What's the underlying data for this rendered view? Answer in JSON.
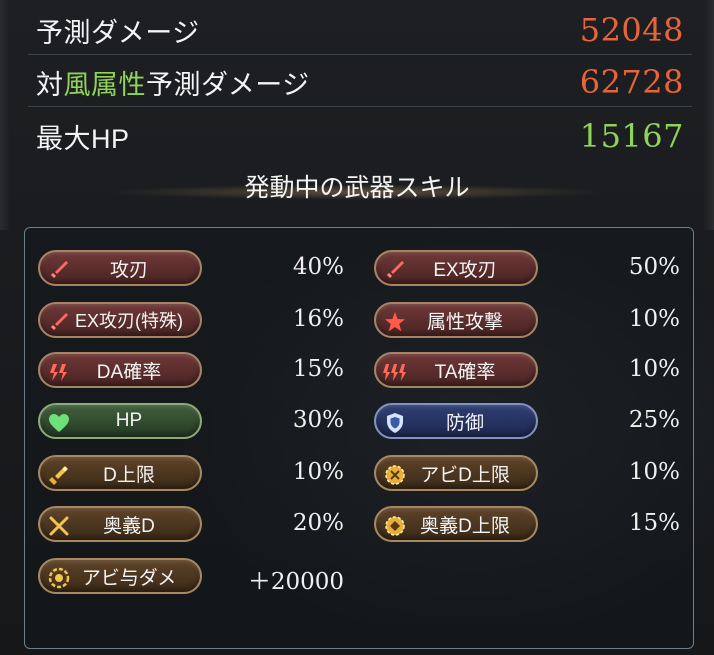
{
  "stats": {
    "predicted_damage": {
      "label": "予測ダメージ",
      "value": "52048"
    },
    "element_damage": {
      "label_prefix": "対",
      "element": "風属性",
      "label_suffix": "予測ダメージ",
      "value": "62728"
    },
    "max_hp": {
      "label": "最大HP",
      "value": "15167"
    }
  },
  "colors": {
    "damage_value": "#e8643a",
    "hp_value": "#8fd35a",
    "element_text": "#8fd35a",
    "panel_border": "#6a7f8c"
  },
  "section_title": "発動中の武器スキル",
  "skills": [
    {
      "name": "攻刃",
      "value": "40%",
      "icon": "sword-icon",
      "color": "red"
    },
    {
      "name": "EX攻刃",
      "value": "50%",
      "icon": "sword-icon",
      "color": "red"
    },
    {
      "name": "EX攻刃(特殊)",
      "value": "16%",
      "icon": "sword-icon",
      "color": "red"
    },
    {
      "name": "属性攻撃",
      "value": "10%",
      "icon": "star-icon",
      "color": "red"
    },
    {
      "name": "DA確率",
      "value": "15%",
      "icon": "double-strike-icon",
      "color": "red"
    },
    {
      "name": "TA確率",
      "value": "10%",
      "icon": "triple-strike-icon",
      "color": "red"
    },
    {
      "name": "HP",
      "value": "30%",
      "icon": "heart-icon",
      "color": "green"
    },
    {
      "name": "防御",
      "value": "25%",
      "icon": "shield-icon",
      "color": "blue"
    },
    {
      "name": "D上限",
      "value": "10%",
      "icon": "damage-cap-icon",
      "color": "brown"
    },
    {
      "name": "アビD上限",
      "value": "10%",
      "icon": "ability-cap-icon",
      "color": "brown"
    },
    {
      "name": "奥義D",
      "value": "20%",
      "icon": "ougi-icon",
      "color": "brown"
    },
    {
      "name": "奥義D上限",
      "value": "15%",
      "icon": "ougi-cap-icon",
      "color": "brown"
    },
    {
      "name": "アビ与ダメ",
      "value": "＋20000",
      "icon": "ability-damage-icon",
      "color": "brown"
    }
  ]
}
